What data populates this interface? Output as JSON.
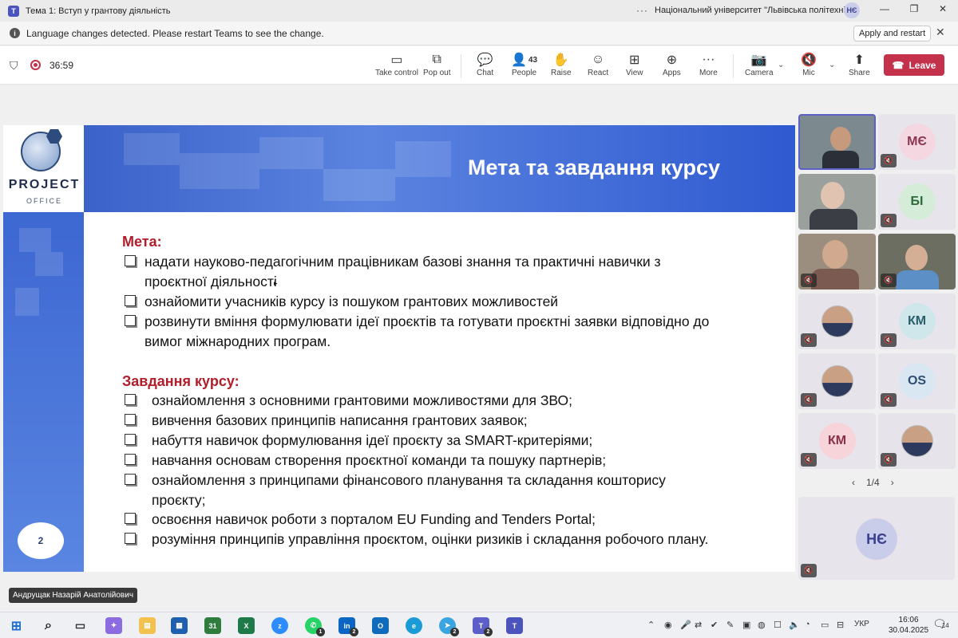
{
  "window": {
    "title": "Тема 1: Вступ у грантову діяльність",
    "more": "···",
    "organization": "Національний університет \"Львівська політехніка\"",
    "user_initials": "НЄ",
    "minimize": "—",
    "restore": "❐",
    "close": "✕"
  },
  "banner": {
    "message": "Language changes detected. Please restart Teams to see the change.",
    "apply_label": "Apply and restart",
    "close": "✕"
  },
  "meeting": {
    "timer": "36:59",
    "buttons": {
      "take_control": "Take control",
      "pop_out": "Pop out",
      "chat": "Chat",
      "people": "People",
      "people_count": "43",
      "raise": "Raise",
      "react": "React",
      "view": "View",
      "apps": "Apps",
      "more": "More",
      "camera": "Camera",
      "mic": "Mic",
      "share": "Share",
      "leave": "Leave"
    }
  },
  "slide": {
    "logo_title": "PROJECT",
    "logo_subtitle": "OFFICE",
    "title": "Мета та завдання курсу",
    "page_number": "2",
    "goal_heading": "Мета:",
    "goals": [
      "надати науково-педагогічним працівникам базові знання та практичні навички з",
      "проєктної діяльності",
      "ознайомити учасників курсу із пошуком грантових можливостей",
      "розвинути вміння формулювати ідеї проєктів та готувати проєктні заявки відповідно до",
      "вимог міжнародних програм."
    ],
    "tasks_heading": "Завдання курсу:",
    "tasks": [
      "ознайомлення з основними грантовими можливостями для ЗВО;",
      "вивчення базових принципів написання грантових заявок;",
      "набуття навичок формулювання ідеї проєкту за SMART-критеріями;",
      "навчання основам створення проєктної команди та пошуку партнерів;",
      "ознайомлення з принципами фінансового планування та складання кошторису",
      "проєкту;",
      "освоєння навичок роботи з порталом EU Funding and Tenders Portal;",
      "розуміння принципів управління проєктом, оцінки ризиків і складання робочого плану."
    ]
  },
  "participants": {
    "initials": [
      "МЄ",
      "БІ",
      "КМ",
      "OS",
      "КМ"
    ],
    "colors": {
      "me": "#f4d7e0",
      "bi": "#d4ecd8",
      "km": "#cfe6ea",
      "os": "#d9e7f3",
      "km2": "#f6d4da"
    },
    "page": "1/4",
    "self_initials": "НЄ"
  },
  "presenter_name": "Андрущак Назарій Анатолійович",
  "taskbar": {
    "badges": [
      "1",
      "2",
      "2",
      "2"
    ],
    "language": "УКР",
    "time": "16:06",
    "date": "30.04.2025",
    "notifications": "14"
  }
}
